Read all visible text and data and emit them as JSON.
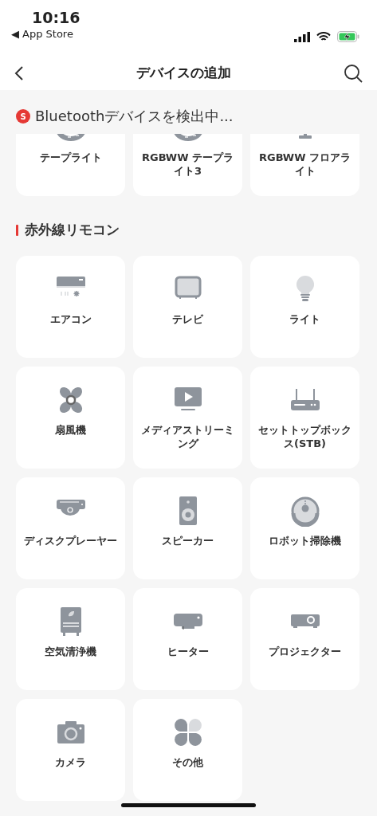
{
  "status_bar": {
    "time": "10:16",
    "back_arrow": "◀",
    "back_app": "App Store"
  },
  "nav": {
    "title": "デバイスの追加"
  },
  "scan": {
    "badge": "S",
    "text": "Bluetoothデバイスを検出中..."
  },
  "bluetooth_devices": [
    {
      "kind": "strip",
      "label": "テープライト"
    },
    {
      "kind": "strip",
      "label": "RGBWW テープライト3"
    },
    {
      "kind": "floor",
      "label": "RGBWW フロアライト"
    }
  ],
  "section": {
    "title": "赤外線リモコン"
  },
  "ir_devices": [
    {
      "kind": "aircon",
      "label": "エアコン"
    },
    {
      "kind": "tv",
      "label": "テレビ"
    },
    {
      "kind": "bulb",
      "label": "ライト"
    },
    {
      "kind": "fan",
      "label": "扇風機"
    },
    {
      "kind": "media",
      "label": "メディアストリーミング"
    },
    {
      "kind": "stb",
      "label": "セットトップボックス(STB)"
    },
    {
      "kind": "disc",
      "label": "ディスクプレーヤー"
    },
    {
      "kind": "speaker",
      "label": "スピーカー"
    },
    {
      "kind": "robot",
      "label": "ロボット掃除機"
    },
    {
      "kind": "purifier",
      "label": "空気清浄機"
    },
    {
      "kind": "heater",
      "label": "ヒーター"
    },
    {
      "kind": "projector",
      "label": "プロジェクター"
    },
    {
      "kind": "camera",
      "label": "カメラ"
    },
    {
      "kind": "other",
      "label": "その他"
    }
  ]
}
